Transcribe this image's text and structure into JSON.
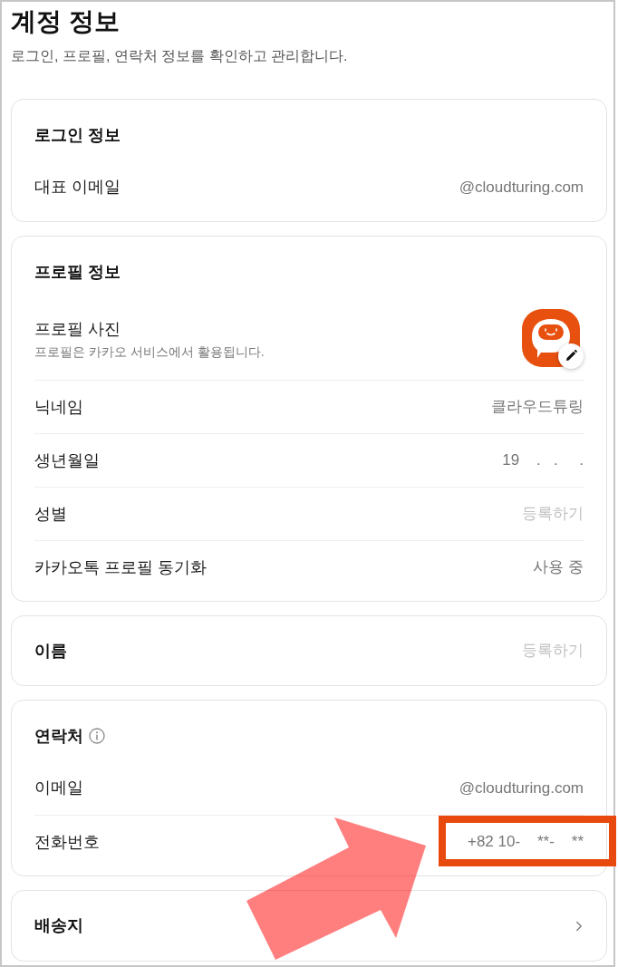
{
  "page": {
    "title": "계정 정보",
    "subtitle": "로그인, 프로필, 연락처 정보를 확인하고 관리합니다."
  },
  "cards": [
    {
      "kind": "section",
      "heading": "로그인 정보",
      "info": false,
      "rows": [
        {
          "kind": "value",
          "label": "대표 이메일",
          "value": "@cloudturing.com",
          "highlighted": false
        }
      ]
    },
    {
      "kind": "section",
      "heading": "프로필 정보",
      "info": false,
      "rows": [
        {
          "kind": "photo",
          "label": "프로필 사진",
          "description": "프로필은 카카오 서비스에서 활용됩니다.",
          "highlighted": false
        },
        {
          "kind": "value",
          "label": "닉네임",
          "value": "클라우드튜링",
          "highlighted": false
        },
        {
          "kind": "value",
          "label": "생년월일",
          "value": "19    .   .     .",
          "highlighted": false
        },
        {
          "kind": "register",
          "label": "성별",
          "value": "등록하기",
          "highlighted": false
        },
        {
          "kind": "value",
          "label": "카카오톡 프로필 동기화",
          "value": "사용 중",
          "highlighted": false
        }
      ]
    },
    {
      "kind": "single",
      "heading": "이름",
      "action": "등록하기"
    },
    {
      "kind": "section",
      "heading": "연락처",
      "info": true,
      "rows": [
        {
          "kind": "value",
          "label": "이메일",
          "value": "@cloudturing.com",
          "highlighted": false
        },
        {
          "kind": "value",
          "label": "전화번호",
          "value": "+82 10-    **-    **",
          "highlighted": true
        }
      ]
    },
    {
      "kind": "link",
      "heading": "배송지"
    }
  ],
  "annotations": [
    {
      "kind": "arrow"
    }
  ]
}
